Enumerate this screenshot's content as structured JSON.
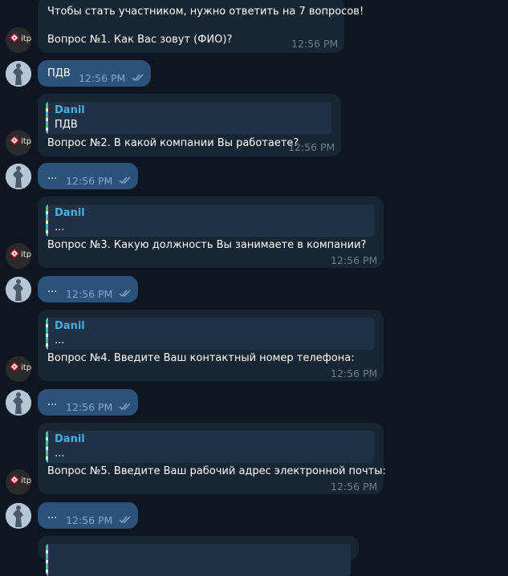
{
  "messages": {
    "m1": {
      "line1": "Чтобы стать участником, нужно ответить на 7 вопросов!",
      "line2": "Вопрос №1. Как Вас зовут (ФИО)?",
      "time": "12:56 PM"
    },
    "r1": {
      "text": "ПДВ",
      "time": "12:56 PM"
    },
    "m2": {
      "quote_name": "Danil",
      "quote_text": "ПДВ",
      "text": "Вопрос №2. В какой компании Вы работаете?",
      "time": "12:56 PM"
    },
    "r2": {
      "text": "...",
      "time": "12:56 PM"
    },
    "m3": {
      "quote_name": "Danil",
      "quote_text": "...",
      "text": "Вопрос №3. Какую должность Вы занимаете в компании?",
      "time": "12:56 PM"
    },
    "r3": {
      "text": "...",
      "time": "12:56 PM"
    },
    "m4": {
      "quote_name": "Danil",
      "quote_text": "...",
      "text": "Вопрос №4. Введите Ваш контактный номер телефона:",
      "time": "12:56 PM"
    },
    "r4": {
      "text": "...",
      "time": "12:56 PM"
    },
    "m5": {
      "quote_name": "Danil",
      "quote_text": "...",
      "text": "Вопрос №5. Введите Ваш рабочий адрес электронной почты:",
      "time": "12:56 PM"
    },
    "r5": {
      "text": "...",
      "time": "12:56 PM"
    }
  },
  "bot_avatar": {
    "logo_text": "itp"
  },
  "icons": {
    "read": "double-check-icon"
  },
  "colors": {
    "background": "#0e1621",
    "incoming_bubble": "#182533",
    "outgoing_bubble": "#2b5278",
    "quote_name": "#45aee6",
    "time_incoming": "#6d7f8f",
    "time_outgoing": "#7da8d3"
  }
}
